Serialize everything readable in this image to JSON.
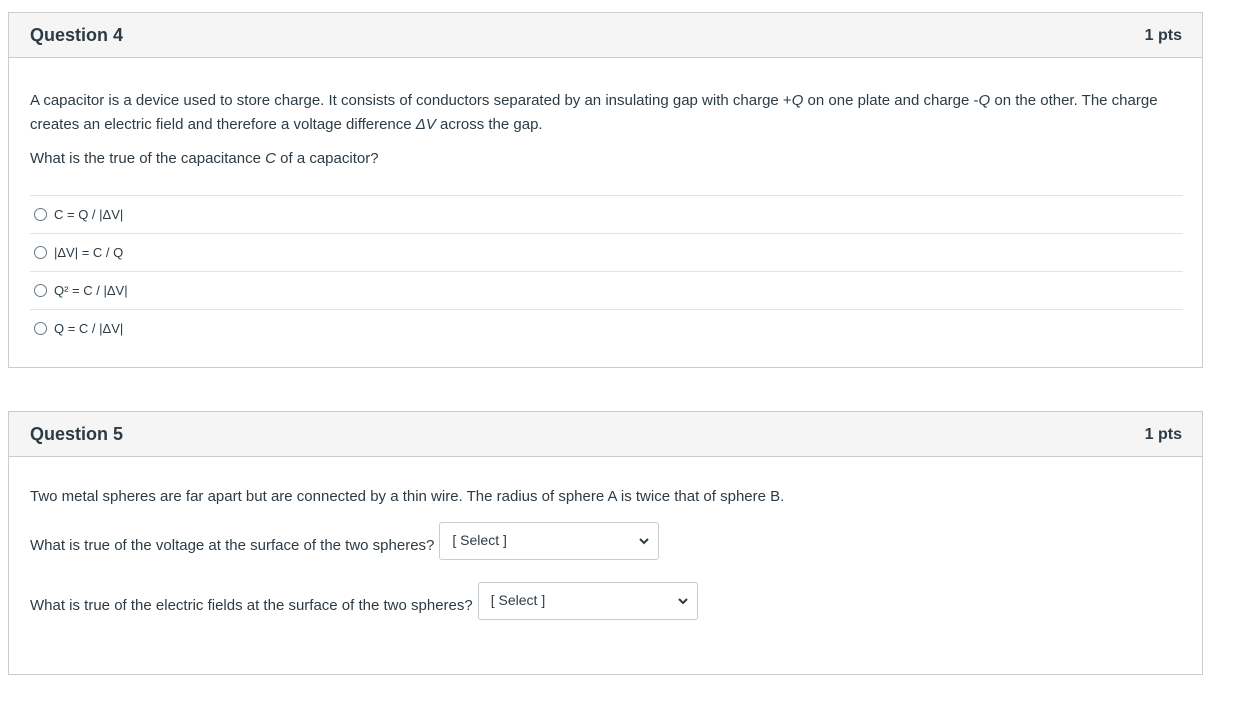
{
  "q4": {
    "title": "Question 4",
    "points": "1 pts",
    "intro_1": "A capacitor is a device used to store charge.  It consists of conductors separated by an insulating gap with charge +",
    "intro_sym_q1": "Q",
    "intro_2": " on one plate and charge -",
    "intro_sym_q2": "Q",
    "intro_3": " on the other.  The charge creates an electric field and therefore a voltage difference ",
    "intro_sym_dv": "ΔV",
    "intro_4": " across the gap.",
    "prompt_1": "What is the true of the capacitance ",
    "prompt_sym_c": "C",
    "prompt_2": " of a capacitor?",
    "answers": [
      "C = Q / |ΔV|",
      "|ΔV| = C / Q",
      "Q² = C / |ΔV|",
      "Q = C / |ΔV|"
    ]
  },
  "q5": {
    "title": "Question 5",
    "points": "1 pts",
    "intro": "Two metal spheres are far apart but are connected by a thin wire.  The radius of sphere A is twice that of sphere B.",
    "prompt_voltage": "What is true of the voltage at the surface of the two spheres?",
    "prompt_field": "What is true of the electric fields at the surface of the two spheres?",
    "select_voltage_value": "[ Select ]",
    "select_field_value": "[ Select ]"
  }
}
